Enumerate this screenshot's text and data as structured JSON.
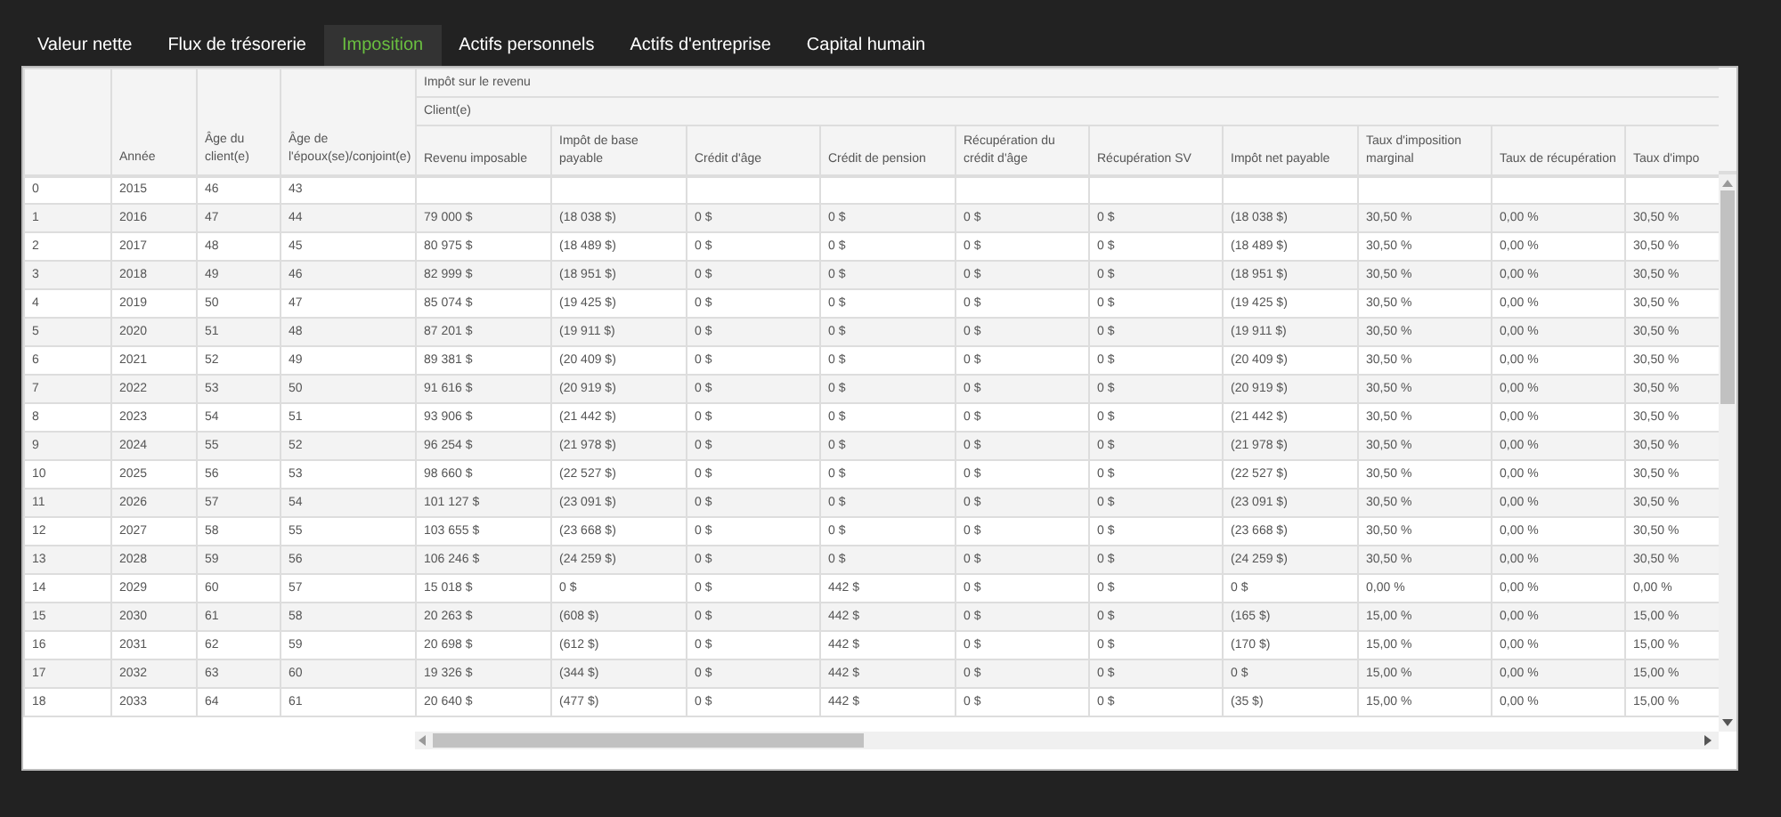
{
  "tabs": [
    {
      "label": "Valeur nette",
      "selected": false
    },
    {
      "label": "Flux de trésorerie",
      "selected": false
    },
    {
      "label": "Imposition",
      "selected": true
    },
    {
      "label": "Actifs personnels",
      "selected": false
    },
    {
      "label": "Actifs d'entreprise",
      "selected": false
    },
    {
      "label": "Capital humain",
      "selected": false
    }
  ],
  "table": {
    "group_headers": [
      "Impôt sur le revenu",
      "Client(e)"
    ],
    "columns": [
      "",
      "Année",
      "Âge du client(e)",
      "Âge de l'époux(se)/conjoint(e)",
      "Revenu imposable",
      "Impôt de base payable",
      "Crédit d'âge",
      "Crédit de pension",
      "Récupération du crédit d'âge",
      "Récupération SV",
      "Impôt net payable",
      "Taux d'imposition marginal",
      "Taux de récupération",
      "Taux d'impo"
    ],
    "rows": [
      {
        "cells": [
          "0",
          "2015",
          "46",
          "43"
        ]
      },
      {
        "cells": [
          "1",
          "2016",
          "47",
          "44",
          "79 000 $",
          "(18 038 $)",
          "0 $",
          "0 $",
          "0 $",
          "0 $",
          "(18 038 $)",
          "30,50 %",
          "0,00 %",
          "30,50 %"
        ]
      },
      {
        "cells": [
          "2",
          "2017",
          "48",
          "45",
          "80 975 $",
          "(18 489 $)",
          "0 $",
          "0 $",
          "0 $",
          "0 $",
          "(18 489 $)",
          "30,50 %",
          "0,00 %",
          "30,50 %"
        ]
      },
      {
        "cells": [
          "3",
          "2018",
          "49",
          "46",
          "82 999 $",
          "(18 951 $)",
          "0 $",
          "0 $",
          "0 $",
          "0 $",
          "(18 951 $)",
          "30,50 %",
          "0,00 %",
          "30,50 %"
        ]
      },
      {
        "cells": [
          "4",
          "2019",
          "50",
          "47",
          "85 074 $",
          "(19 425 $)",
          "0 $",
          "0 $",
          "0 $",
          "0 $",
          "(19 425 $)",
          "30,50 %",
          "0,00 %",
          "30,50 %"
        ]
      },
      {
        "cells": [
          "5",
          "2020",
          "51",
          "48",
          "87 201 $",
          "(19 911 $)",
          "0 $",
          "0 $",
          "0 $",
          "0 $",
          "(19 911 $)",
          "30,50 %",
          "0,00 %",
          "30,50 %"
        ]
      },
      {
        "cells": [
          "6",
          "2021",
          "52",
          "49",
          "89 381 $",
          "(20 409 $)",
          "0 $",
          "0 $",
          "0 $",
          "0 $",
          "(20 409 $)",
          "30,50 %",
          "0,00 %",
          "30,50 %"
        ]
      },
      {
        "cells": [
          "7",
          "2022",
          "53",
          "50",
          "91 616 $",
          "(20 919 $)",
          "0 $",
          "0 $",
          "0 $",
          "0 $",
          "(20 919 $)",
          "30,50 %",
          "0,00 %",
          "30,50 %"
        ]
      },
      {
        "cells": [
          "8",
          "2023",
          "54",
          "51",
          "93 906 $",
          "(21 442 $)",
          "0 $",
          "0 $",
          "0 $",
          "0 $",
          "(21 442 $)",
          "30,50 %",
          "0,00 %",
          "30,50 %"
        ]
      },
      {
        "cells": [
          "9",
          "2024",
          "55",
          "52",
          "96 254 $",
          "(21 978 $)",
          "0 $",
          "0 $",
          "0 $",
          "0 $",
          "(21 978 $)",
          "30,50 %",
          "0,00 %",
          "30,50 %"
        ]
      },
      {
        "cells": [
          "10",
          "2025",
          "56",
          "53",
          "98 660 $",
          "(22 527 $)",
          "0 $",
          "0 $",
          "0 $",
          "0 $",
          "(22 527 $)",
          "30,50 %",
          "0,00 %",
          "30,50 %"
        ]
      },
      {
        "cells": [
          "11",
          "2026",
          "57",
          "54",
          "101 127 $",
          "(23 091 $)",
          "0 $",
          "0 $",
          "0 $",
          "0 $",
          "(23 091 $)",
          "30,50 %",
          "0,00 %",
          "30,50 %"
        ]
      },
      {
        "cells": [
          "12",
          "2027",
          "58",
          "55",
          "103 655 $",
          "(23 668 $)",
          "0 $",
          "0 $",
          "0 $",
          "0 $",
          "(23 668 $)",
          "30,50 %",
          "0,00 %",
          "30,50 %"
        ]
      },
      {
        "cells": [
          "13",
          "2028",
          "59",
          "56",
          "106 246 $",
          "(24 259 $)",
          "0 $",
          "0 $",
          "0 $",
          "0 $",
          "(24 259 $)",
          "30,50 %",
          "0,00 %",
          "30,50 %"
        ]
      },
      {
        "cells": [
          "14",
          "2029",
          "60",
          "57",
          "15 018 $",
          "0 $",
          "0 $",
          "442 $",
          "0 $",
          "0 $",
          "0 $",
          "0,00 %",
          "0,00 %",
          "0,00 %"
        ]
      },
      {
        "cells": [
          "15",
          "2030",
          "61",
          "58",
          "20 263 $",
          "(608 $)",
          "0 $",
          "442 $",
          "0 $",
          "0 $",
          "(165 $)",
          "15,00 %",
          "0,00 %",
          "15,00 %"
        ]
      },
      {
        "cells": [
          "16",
          "2031",
          "62",
          "59",
          "20 698 $",
          "(612 $)",
          "0 $",
          "442 $",
          "0 $",
          "0 $",
          "(170 $)",
          "15,00 %",
          "0,00 %",
          "15,00 %"
        ]
      },
      {
        "cells": [
          "17",
          "2032",
          "63",
          "60",
          "19 326 $",
          "(344 $)",
          "0 $",
          "442 $",
          "0 $",
          "0 $",
          "0 $",
          "15,00 %",
          "0,00 %",
          "15,00 %"
        ]
      },
      {
        "cells": [
          "18",
          "2033",
          "64",
          "61",
          "20 640 $",
          "(477 $)",
          "0 $",
          "442 $",
          "0 $",
          "0 $",
          "(35 $)",
          "15,00 %",
          "0,00 %",
          "15,00 %"
        ]
      }
    ]
  }
}
